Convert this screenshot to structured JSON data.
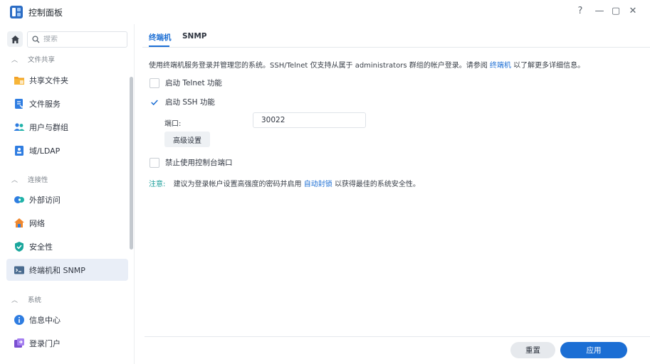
{
  "window": {
    "title": "控制面板",
    "controls": {
      "help": "?",
      "minimize": "—",
      "maximize": "▢",
      "close": "✕"
    }
  },
  "sidebar": {
    "search_placeholder": "搜索",
    "sections": {
      "file_sharing": "文件共享",
      "connectivity": "连接性",
      "system": "系统"
    },
    "items": [
      {
        "label": "共享文件夹",
        "icon": "shared-folder-icon"
      },
      {
        "label": "文件服务",
        "icon": "file-services-icon"
      },
      {
        "label": "用户与群组",
        "icon": "users-groups-icon"
      },
      {
        "label": "域/LDAP",
        "icon": "domain-ldap-icon"
      },
      {
        "label": "外部访问",
        "icon": "external-access-icon"
      },
      {
        "label": "网络",
        "icon": "network-icon"
      },
      {
        "label": "安全性",
        "icon": "security-icon"
      },
      {
        "label": "终端机和 SNMP",
        "icon": "terminal-snmp-icon",
        "active": true
      },
      {
        "label": "信息中心",
        "icon": "info-center-icon"
      },
      {
        "label": "登录门户",
        "icon": "login-portal-icon"
      }
    ]
  },
  "tabs": [
    {
      "label": "终端机",
      "active": true
    },
    {
      "label": "SNMP",
      "active": false
    }
  ],
  "content": {
    "description_prefix": "使用终端机服务登录并管理您的系统。SSH/Telnet 仅支持从属于 administrators 群组的帐户登录。请参阅",
    "description_link": "终端机",
    "description_suffix": "以了解更多详细信息。",
    "enable_telnet": {
      "label": "启动 Telnet 功能",
      "checked": false
    },
    "enable_ssh": {
      "label": "启动 SSH 功能",
      "checked": true
    },
    "port_label": "端口:",
    "port_value": "30022",
    "advanced_button": "高级设置",
    "disable_console": {
      "label": "禁止使用控制台端口",
      "checked": false
    },
    "note_label": "注意:",
    "note_prefix": "建议为登录帐户设置高强度的密码并启用",
    "note_link": "自动封锁",
    "note_suffix": "以获得最佳的系统安全性。"
  },
  "footer": {
    "reset_label": "重置",
    "apply_label": "应用"
  },
  "colors": {
    "accent": "#1b6ed4",
    "note": "#1b9e9a",
    "active_nav_bg": "#e9eef7"
  }
}
